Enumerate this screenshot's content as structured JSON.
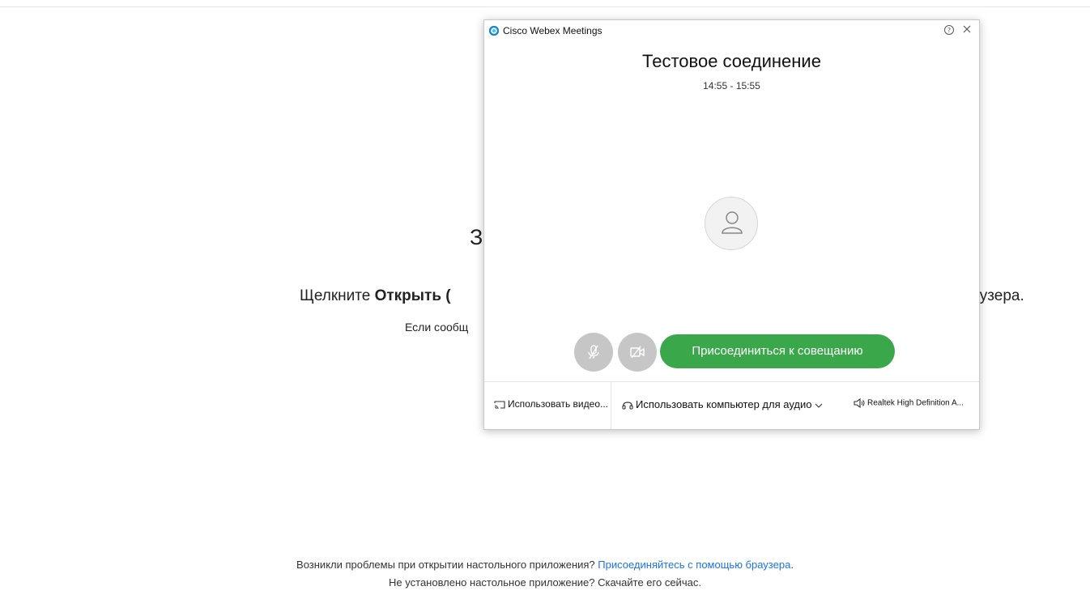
{
  "page": {
    "heading_fragment": "З",
    "instruction_left_prefix": "Щелкните ",
    "instruction_left_bold": "Открыть (",
    "instruction_right": "браузера.",
    "sub_fragment": "Если сообщ",
    "footer_line1_text": "Возникли проблемы при открытии настольного приложения? ",
    "footer_line1_link": "Присоединяйтесь с помощью браузера",
    "footer_line1_end": ".",
    "footer_line2": "Не установлено настольное приложение? Скачайте его сейчас."
  },
  "dialog": {
    "app_title": "Cisco Webex Meetings",
    "meeting_title": "Тестовое соединение",
    "meeting_time": "14:55 - 15:55",
    "join_label": "Присоединиться к совещанию",
    "video_label": "Использовать видео...",
    "audio_label": "Использовать компьютер для аудио",
    "speaker_label": "Realtek High Definition A...",
    "accent_color": "#3aa74a",
    "icons": [
      "webex-logo-icon",
      "help-icon",
      "close-icon",
      "user-icon",
      "mic-muted-icon",
      "video-off-icon",
      "cast-icon",
      "headset-icon",
      "chevron-down-icon",
      "speaker-icon"
    ]
  }
}
